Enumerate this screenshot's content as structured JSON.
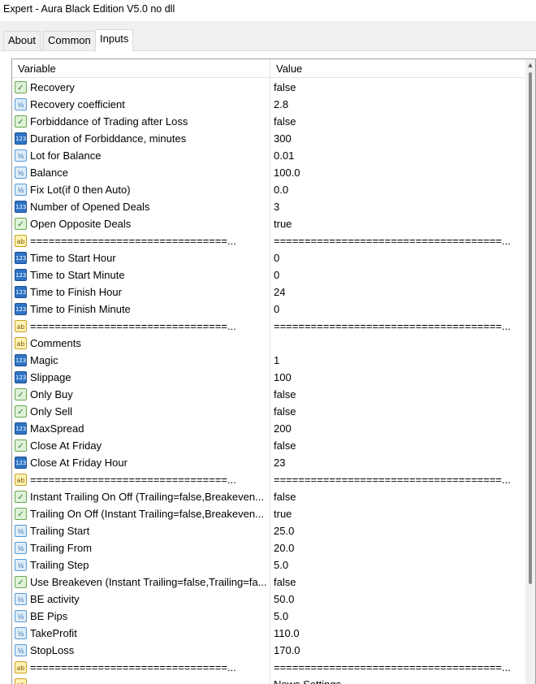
{
  "window": {
    "title": "Expert - Aura Black Edition V5.0 no dll"
  },
  "tabs": [
    {
      "label": "About"
    },
    {
      "label": "Common"
    },
    {
      "label": "Inputs"
    }
  ],
  "grid": {
    "columns": {
      "variable": "Variable",
      "value": "Value"
    },
    "rows": [
      {
        "type": "bool",
        "icon": "bool-icon",
        "variable": "Recovery",
        "value": "false"
      },
      {
        "type": "double",
        "icon": "double-icon",
        "variable": "Recovery coefficient",
        "value": "2.8"
      },
      {
        "type": "bool",
        "icon": "bool-icon",
        "variable": "Forbiddance of Trading after Loss",
        "value": "false"
      },
      {
        "type": "int",
        "icon": "int-icon",
        "variable": "Duration of Forbiddance, minutes",
        "value": "300"
      },
      {
        "type": "double",
        "icon": "double-icon",
        "variable": "Lot for Balance",
        "value": "0.01"
      },
      {
        "type": "double",
        "icon": "double-icon",
        "variable": "Balance",
        "value": "100.0"
      },
      {
        "type": "double",
        "icon": "double-icon",
        "variable": "Fix Lot(if 0 then Auto)",
        "value": "0.0"
      },
      {
        "type": "int",
        "icon": "int-icon",
        "variable": "Number of Opened Deals",
        "value": "3"
      },
      {
        "type": "bool",
        "icon": "bool-icon",
        "variable": "Open Opposite Deals",
        "value": "true"
      },
      {
        "type": "string",
        "icon": "string-icon",
        "variable": "================================...",
        "value": "=====================================..."
      },
      {
        "type": "int",
        "icon": "int-icon",
        "variable": "Time to Start Hour",
        "value": "0"
      },
      {
        "type": "int",
        "icon": "int-icon",
        "variable": "Time to Start Minute",
        "value": "0"
      },
      {
        "type": "int",
        "icon": "int-icon",
        "variable": "Time to Finish Hour",
        "value": "24"
      },
      {
        "type": "int",
        "icon": "int-icon",
        "variable": "Time to Finish Minute",
        "value": "0"
      },
      {
        "type": "string",
        "icon": "string-icon",
        "variable": "================================...",
        "value": "=====================================..."
      },
      {
        "type": "string",
        "icon": "string-icon",
        "variable": "Comments",
        "value": ""
      },
      {
        "type": "int",
        "icon": "int-icon",
        "variable": "Magic",
        "value": "1"
      },
      {
        "type": "int",
        "icon": "int-icon",
        "variable": "Slippage",
        "value": "100"
      },
      {
        "type": "bool",
        "icon": "bool-icon",
        "variable": "Only Buy",
        "value": "false"
      },
      {
        "type": "bool",
        "icon": "bool-icon",
        "variable": "Only Sell",
        "value": "false"
      },
      {
        "type": "int",
        "icon": "int-icon",
        "variable": "MaxSpread",
        "value": "200"
      },
      {
        "type": "bool",
        "icon": "bool-icon",
        "variable": "Close At Friday",
        "value": "false"
      },
      {
        "type": "int",
        "icon": "int-icon",
        "variable": "Close At Friday Hour",
        "value": "23"
      },
      {
        "type": "string",
        "icon": "string-icon",
        "variable": "================================...",
        "value": "=====================================..."
      },
      {
        "type": "bool",
        "icon": "bool-icon",
        "variable": "Instant Trailing On Off (Trailing=false,Breakeven...",
        "value": "false"
      },
      {
        "type": "bool",
        "icon": "bool-icon",
        "variable": "Trailing On Off (Instant Trailing=false,Breakeven...",
        "value": "true"
      },
      {
        "type": "double",
        "icon": "double-icon",
        "variable": "Trailing Start",
        "value": "25.0"
      },
      {
        "type": "double",
        "icon": "double-icon",
        "variable": "Trailing From",
        "value": "20.0"
      },
      {
        "type": "double",
        "icon": "double-icon",
        "variable": "Trailing Step",
        "value": "5.0"
      },
      {
        "type": "bool",
        "icon": "bool-icon",
        "variable": "Use Breakeven (Instant Trailing=false,Trailing=fa...",
        "value": "false"
      },
      {
        "type": "double",
        "icon": "double-icon",
        "variable": "BE activity",
        "value": "50.0"
      },
      {
        "type": "double",
        "icon": "double-icon",
        "variable": "BE Pips",
        "value": "5.0"
      },
      {
        "type": "double",
        "icon": "double-icon",
        "variable": "TakeProfit",
        "value": "110.0"
      },
      {
        "type": "double",
        "icon": "double-icon",
        "variable": "StopLoss",
        "value": "170.0"
      },
      {
        "type": "string",
        "icon": "string-icon",
        "variable": "================================...",
        "value": "=====================================..."
      },
      {
        "type": "string",
        "icon": "string-icon",
        "variable": "",
        "value": "News Settings"
      }
    ]
  },
  "icon_glyphs": {
    "bool": "✓",
    "double": "½",
    "int": "123",
    "string": "ab"
  }
}
